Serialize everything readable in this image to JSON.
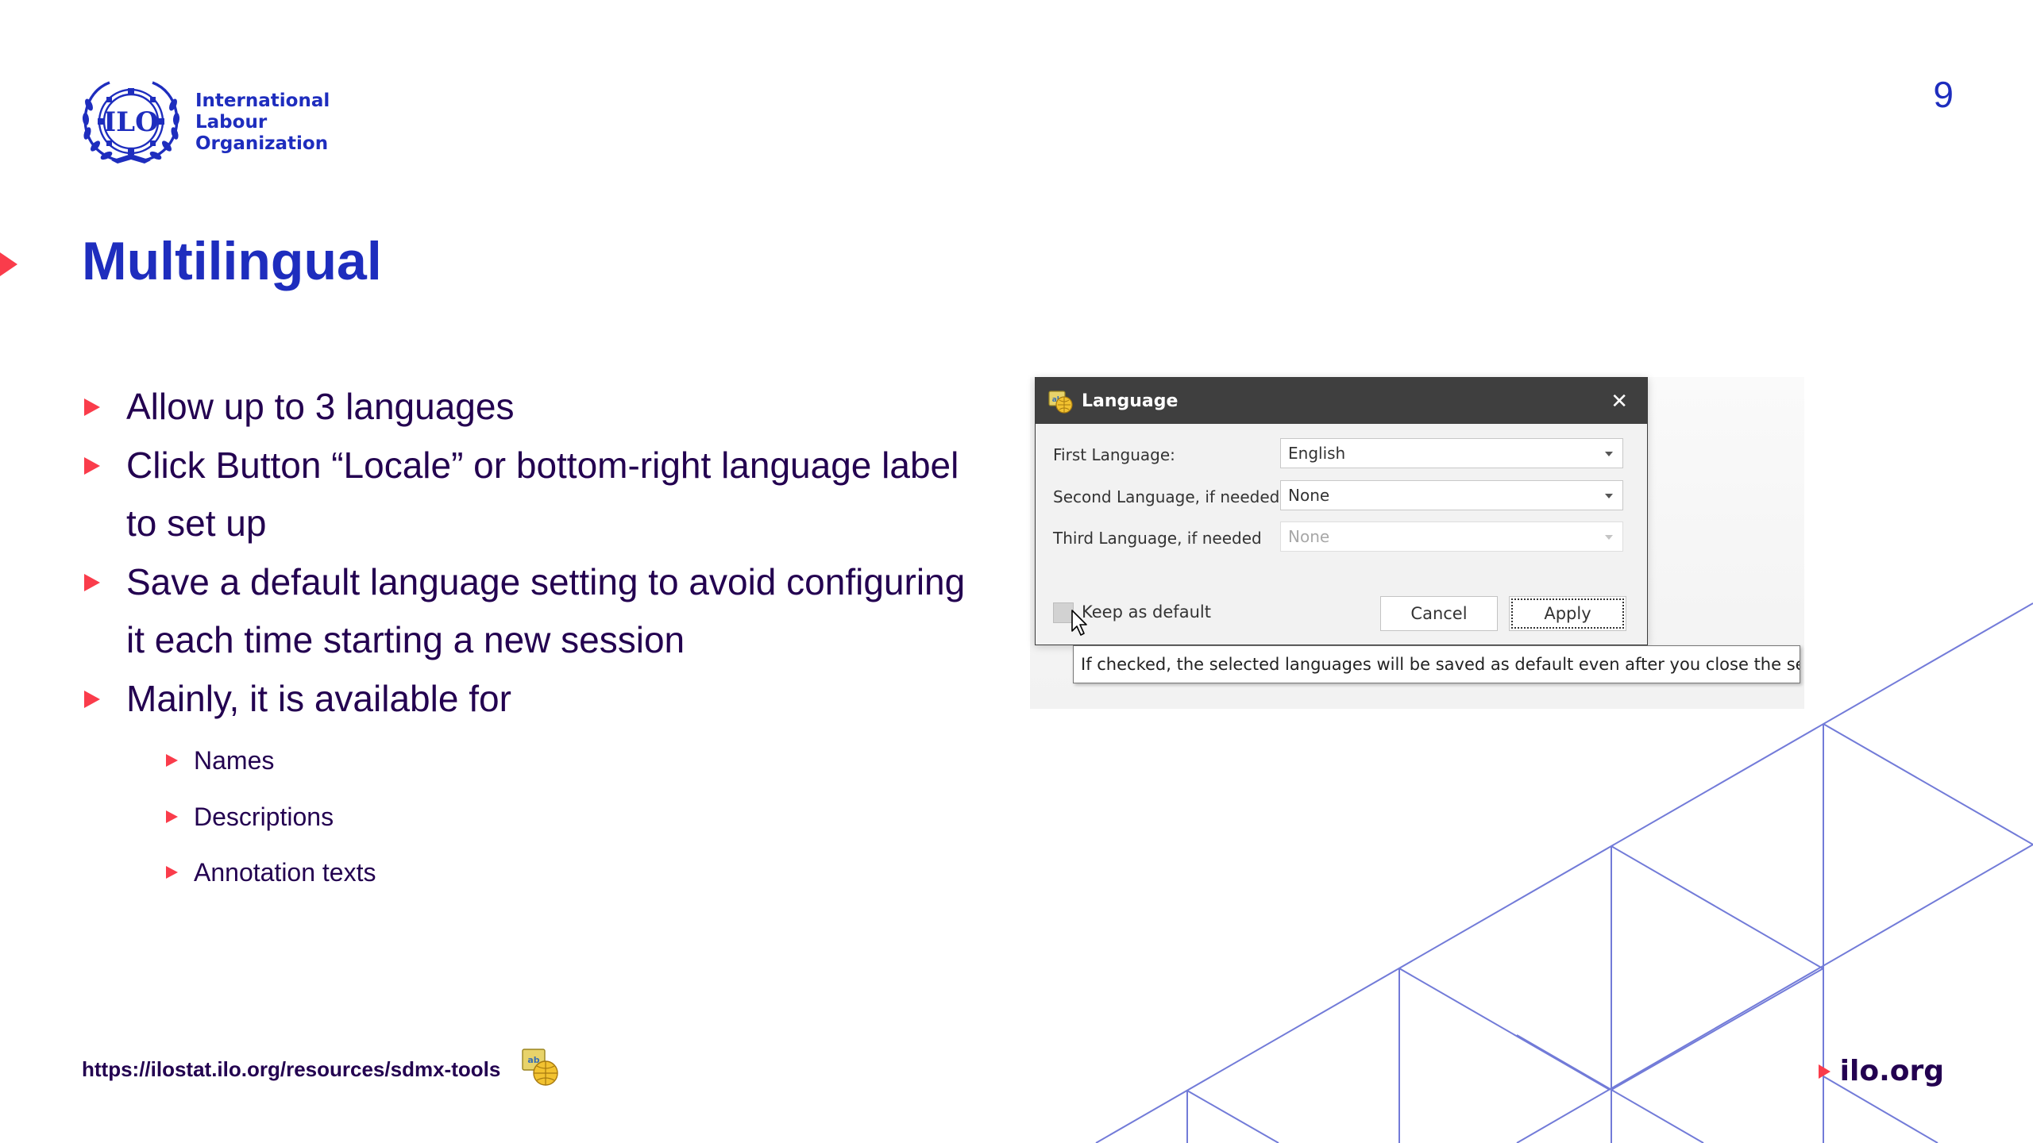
{
  "slide": {
    "page_number": "9",
    "title": "Multilingual"
  },
  "logo": {
    "line1": "International",
    "line2": "Labour",
    "line3": "Organization",
    "emblem_text": "ILO",
    "icon": "ilo-emblem-icon"
  },
  "bullets": {
    "items": [
      "Allow up to 3 languages",
      "Click Button “Locale” or bottom-right language label",
      "to set up",
      "Save a default language setting to avoid configuring",
      "it each time starting a new session",
      "Mainly, it is available for"
    ],
    "sub_items": [
      "Names",
      "Descriptions",
      "Annotation texts"
    ]
  },
  "dialog": {
    "title": "Language",
    "icon": "language-app-icon",
    "close_icon": "close-icon",
    "close_glyph": "✕",
    "first_label": "First Language:",
    "first_value": "English",
    "second_label": "Second Language, if needed",
    "second_value": "None",
    "third_label": "Third Language, if needed",
    "third_value": "None",
    "checkbox_label": "Keep as default",
    "cancel_label": "Cancel",
    "apply_label": "Apply",
    "tooltip": "If checked, the selected languages will be saved as default even after you close the session."
  },
  "footer": {
    "url": "https://ilostat.ilo.org/resources/sdmx-tools",
    "brand": "ilo.org"
  },
  "colors": {
    "accent_blue": "#1e2dbe",
    "text_dark": "#230050",
    "bullet_red": "#fa3c4b",
    "pattern_line": "#5a64d2",
    "dialog_titlebar": "#3f3f3f"
  }
}
